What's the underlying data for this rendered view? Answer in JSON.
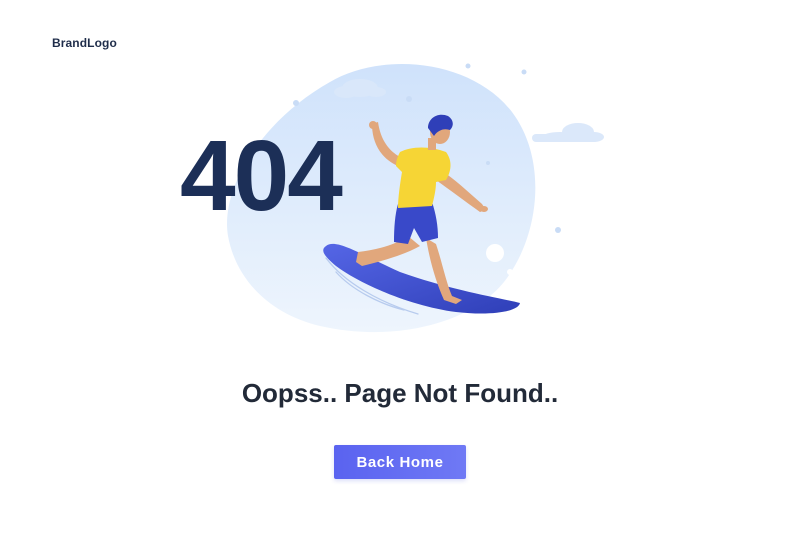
{
  "brand": {
    "logo_text": "BrandLogo"
  },
  "error": {
    "code": "404",
    "message": "Oopss.. Page Not Found.."
  },
  "actions": {
    "back_home_label": "Back Home"
  },
  "colors": {
    "primary_button": "#5a63f0",
    "heading": "#1c2f57",
    "blob": "#dce9fb",
    "shirt": "#f6d535",
    "shorts": "#3949c9",
    "surfboard": "#4456d4"
  },
  "icons": {
    "illustration": "surfer-illustration",
    "clouds": "cloud-icon"
  }
}
